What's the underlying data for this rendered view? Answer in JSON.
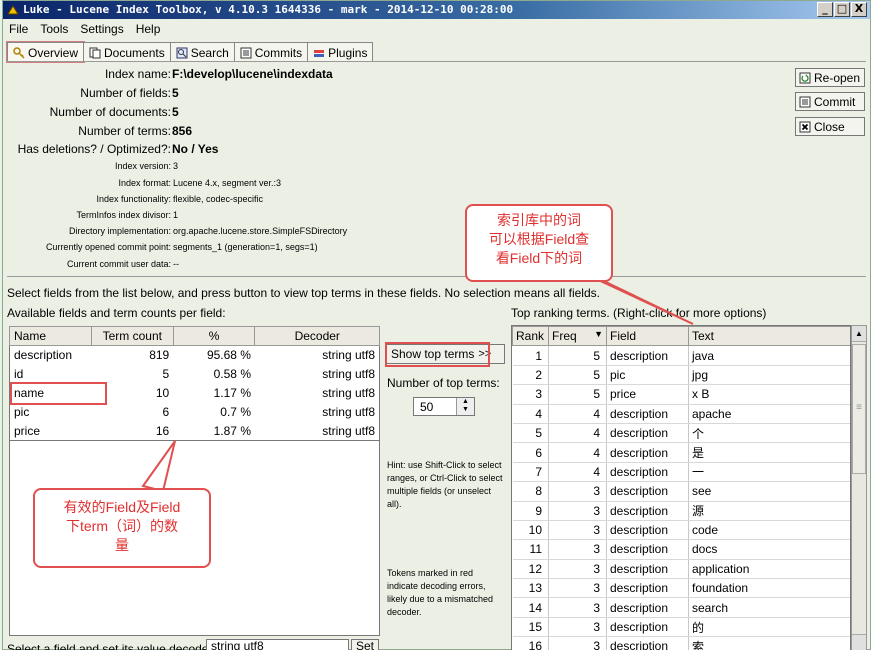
{
  "window": {
    "title": "Luke - Lucene Index Toolbox, v 4.10.3 1644336 - mark - 2014-12-10 00:28:00",
    "controls": [
      "_",
      "□",
      "X"
    ]
  },
  "menu": [
    "File",
    "Tools",
    "Settings",
    "Help"
  ],
  "tabs": [
    {
      "label": "Overview",
      "icon": "key-icon"
    },
    {
      "label": "Documents",
      "icon": "documents-icon"
    },
    {
      "label": "Search",
      "icon": "search-icon"
    },
    {
      "label": "Commits",
      "icon": "commits-icon"
    },
    {
      "label": "Plugins",
      "icon": "plugins-icon"
    }
  ],
  "overview": {
    "index_name_label": "Index name:",
    "index_name": "F:\\develop\\lucene\\indexdata",
    "num_fields_label": "Number of fields:",
    "num_fields": "5",
    "num_docs_label": "Number of documents:",
    "num_docs": "5",
    "num_terms_label": "Number of terms:",
    "num_terms": "856",
    "deletions_label": "Has deletions? / Optimized?:",
    "deletions": "No / Yes",
    "index_version_label": "Index version:",
    "index_version": "3",
    "index_format_label": "Index format:",
    "index_format": "Lucene 4.x, segment ver.:3",
    "index_functionality_label": "Index functionality:",
    "index_functionality": "flexible, codec-specific",
    "terminfos_label": "TermInfos index divisor:",
    "terminfos": "1",
    "directory_label": "Directory implementation:",
    "directory": "org.apache.lucene.store.SimpleFSDirectory",
    "commit_point_label": "Currently opened commit point:",
    "commit_point": "segments_1 (generation=1, segs=1)",
    "commit_user_label": "Current commit user data:",
    "commit_user": "--"
  },
  "actions": {
    "reopen": "Re-open",
    "commit": "Commit",
    "close": "Close"
  },
  "select_hint": "Select fields from the list below, and press button to view top terms in these fields. No selection means all fields.",
  "fields_panel": {
    "title": "Available fields and term counts per field:",
    "columns": [
      "Name",
      "Term count",
      "%",
      "Decoder"
    ],
    "rows": [
      {
        "name": "description",
        "count": "819",
        "pct": "95.68 %",
        "decoder": "string utf8"
      },
      {
        "name": "id",
        "count": "5",
        "pct": "0.58 %",
        "decoder": "string utf8"
      },
      {
        "name": "name",
        "count": "10",
        "pct": "1.17 %",
        "decoder": "string utf8"
      },
      {
        "name": "pic",
        "count": "6",
        "pct": "0.7 %",
        "decoder": "string utf8"
      },
      {
        "name": "price",
        "count": "16",
        "pct": "1.87 %",
        "decoder": "string utf8"
      }
    ],
    "bottom_label": "Select a field and set its value decoder:",
    "decoder_select": "string utf8",
    "set_button": "Set"
  },
  "middle": {
    "show_top_terms": "Show top terms",
    "show_arrow": ">>",
    "num_top_terms_label": "Number of top terms:",
    "num_top_terms": "50",
    "hint1": "Hint: use Shift-Click to select ranges, or Ctrl-Click to select multiple fields (or unselect all).",
    "hint2": "Tokens marked in red indicate decoding errors, likely due to a mismatched decoder."
  },
  "top_terms": {
    "title": "Top ranking terms. (Right-click for more options)",
    "columns": [
      "Rank",
      "Freq",
      "Field",
      "Text"
    ],
    "rows": [
      {
        "rank": "1",
        "freq": "5",
        "field": "description",
        "text": "java"
      },
      {
        "rank": "2",
        "freq": "5",
        "field": "pic",
        "text": "jpg"
      },
      {
        "rank": "3",
        "freq": "5",
        "field": "price",
        "text": "x B"
      },
      {
        "rank": "4",
        "freq": "4",
        "field": "description",
        "text": "apache"
      },
      {
        "rank": "5",
        "freq": "4",
        "field": "description",
        "text": "个"
      },
      {
        "rank": "6",
        "freq": "4",
        "field": "description",
        "text": "是"
      },
      {
        "rank": "7",
        "freq": "4",
        "field": "description",
        "text": "一"
      },
      {
        "rank": "8",
        "freq": "3",
        "field": "description",
        "text": "see"
      },
      {
        "rank": "9",
        "freq": "3",
        "field": "description",
        "text": "源"
      },
      {
        "rank": "10",
        "freq": "3",
        "field": "description",
        "text": "code"
      },
      {
        "rank": "11",
        "freq": "3",
        "field": "description",
        "text": "docs"
      },
      {
        "rank": "12",
        "freq": "3",
        "field": "description",
        "text": "application"
      },
      {
        "rank": "13",
        "freq": "3",
        "field": "description",
        "text": "foundation"
      },
      {
        "rank": "14",
        "freq": "3",
        "field": "description",
        "text": "search"
      },
      {
        "rank": "15",
        "freq": "3",
        "field": "description",
        "text": "的"
      },
      {
        "rank": "16",
        "freq": "3",
        "field": "description",
        "text": "索"
      }
    ]
  },
  "annotations": {
    "top_note": "索引库中的词\n可以根据Field查\n看Field下的词",
    "left_note": "有效的Field及Field\n下term（词）的数\n量",
    "color": "#e05050"
  }
}
